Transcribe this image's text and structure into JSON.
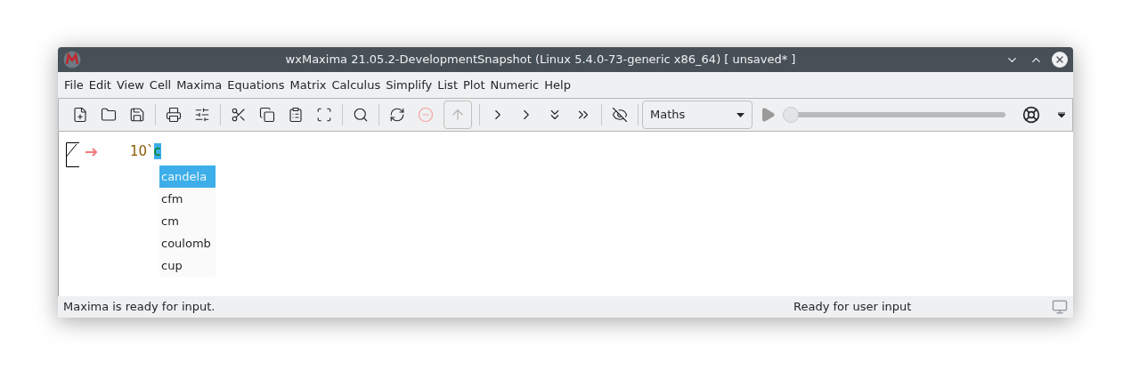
{
  "window": {
    "title": "wxMaxima 21.05.2-DevelopmentSnapshot (Linux 5.4.0-73-generic x86_64) [ unsaved* ]"
  },
  "menu": [
    "File",
    "Edit",
    "View",
    "Cell",
    "Maxima",
    "Equations",
    "Matrix",
    "Calculus",
    "Simplify",
    "List",
    "Plot",
    "Numeric",
    "Help"
  ],
  "toolbar": {
    "buttons": [
      {
        "disabled": false
      },
      {
        "disabled": false
      },
      {
        "disabled": false
      },
      {
        "disabled": false
      },
      {
        "disabled": false
      },
      {
        "disabled": false
      },
      {
        "disabled": false
      },
      {
        "disabled": false
      },
      {
        "disabled": false
      },
      {
        "disabled": false
      },
      {
        "disabled": false
      },
      {
        "disabled": true
      },
      {
        "disabled": true
      },
      {
        "disabled": false
      },
      {
        "disabled": false
      },
      {
        "disabled": false
      },
      {
        "disabled": false
      },
      {
        "disabled": false
      }
    ],
    "style_select": "Maths",
    "animation": {
      "level": 0
    }
  },
  "cell": {
    "input": "10`",
    "selection": "c"
  },
  "completions": [
    {
      "label": "candela",
      "selected": true
    },
    {
      "label": "cfm",
      "selected": false
    },
    {
      "label": "cm",
      "selected": false
    },
    {
      "label": "coulomb",
      "selected": false
    },
    {
      "label": "cup",
      "selected": false
    }
  ],
  "status_bar": {
    "left": "Maxima is ready for input.",
    "right": "Ready for user input"
  }
}
